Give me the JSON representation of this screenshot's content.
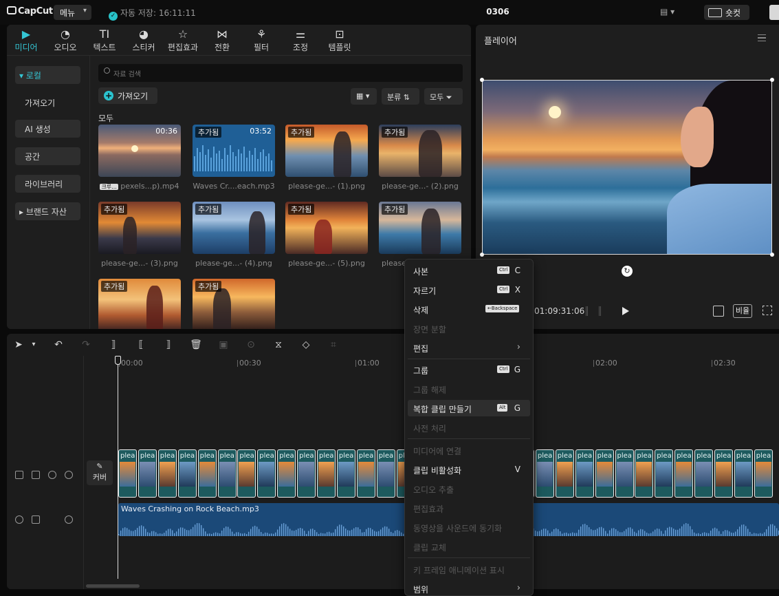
{
  "titlebar": {
    "logo": "CapCut",
    "menu_label": "메뉴",
    "autosave": "자동 저장: 16:11:11",
    "project_title": "0306",
    "shortcut_label": "숏컷"
  },
  "tabs": [
    {
      "label": "미디어",
      "icon": "media-icon",
      "active": true
    },
    {
      "label": "오디오",
      "icon": "audio-icon"
    },
    {
      "label": "텍스트",
      "icon": "text-icon"
    },
    {
      "label": "스티커",
      "icon": "sticker-icon"
    },
    {
      "label": "편집효과",
      "icon": "effects-icon"
    },
    {
      "label": "전환",
      "icon": "transition-icon"
    },
    {
      "label": "필터",
      "icon": "filter-icon"
    },
    {
      "label": "조정",
      "icon": "adjust-icon"
    },
    {
      "label": "템플릿",
      "icon": "template-icon"
    }
  ],
  "sidebar": {
    "items": [
      {
        "label": "로컬",
        "active": true
      },
      {
        "label": "가져오기"
      },
      {
        "label": "AI 생성"
      },
      {
        "label": "공간"
      },
      {
        "label": "라이브러리"
      },
      {
        "label": "브랜드 자산"
      }
    ]
  },
  "media": {
    "search_placeholder": "자료 검색",
    "import_label": "가져오기",
    "sort_label": "분류",
    "filter_label": "모두",
    "section_label": "모두",
    "items": [
      {
        "name": "pexels...p).mp4",
        "badge": "",
        "duration": "00:36",
        "icon_label": "크루..."
      },
      {
        "name": "Waves Cr....each.mp3",
        "badge": "추가됨",
        "duration": "03:52"
      },
      {
        "name": "please-ge...- (1).png",
        "badge": "추가됨"
      },
      {
        "name": "please-ge...- (2).png",
        "badge": "추가됨"
      },
      {
        "name": "please-ge...- (3).png",
        "badge": "추가됨"
      },
      {
        "name": "please-ge...- (4).png",
        "badge": "추가됨"
      },
      {
        "name": "please-ge...- (5).png",
        "badge": "추가됨"
      },
      {
        "name": "please",
        "badge": "추가됨"
      },
      {
        "name": "",
        "badge": "추가됨"
      },
      {
        "name": "",
        "badge": "추가됨"
      }
    ]
  },
  "player": {
    "title": "플레이어",
    "timecode": "01:09:31:06",
    "ratio_label": "비율"
  },
  "timeline": {
    "ruler": [
      "00:00",
      "00:30",
      "01:00",
      "02:00",
      "02:30"
    ],
    "cover_label": "커버",
    "clip_label": "plea",
    "audio_clip_label": "Waves Crashing on Rock Beach.mp3"
  },
  "context_menu": {
    "items": [
      {
        "label": "사본",
        "kbd": "Ctrl",
        "key": "C"
      },
      {
        "label": "자르기",
        "kbd": "Ctrl",
        "key": "X"
      },
      {
        "label": "삭제",
        "kbd": "←Backspace"
      },
      {
        "label": "장면 분할",
        "disabled": true
      },
      {
        "label": "편집",
        "submenu": true
      },
      {
        "label": "그룹",
        "kbd": "Ctrl",
        "key": "G"
      },
      {
        "label": "그룹 해제",
        "disabled": true
      },
      {
        "label": "복합 클립 만들기",
        "kbd": "Alt",
        "key": "G",
        "hover": true
      },
      {
        "label": "사전 처리",
        "disabled": true
      },
      {
        "label": "미디어에 연결",
        "disabled": true
      },
      {
        "label": "클립 비활성화",
        "key": "V"
      },
      {
        "label": "오디오 추출",
        "disabled": true
      },
      {
        "label": "편집효과",
        "disabled": true
      },
      {
        "label": "동영상을 사운드에 동기화",
        "disabled": true
      },
      {
        "label": "클립 교체",
        "disabled": true
      },
      {
        "label": "키 프레임 애니메이션 표시",
        "disabled": true
      },
      {
        "label": "범위",
        "submenu": true
      }
    ]
  },
  "colors": {
    "accent": "#35c6d4",
    "video_clip": "#1d5a5e",
    "audio_clip": "#1b4978"
  }
}
